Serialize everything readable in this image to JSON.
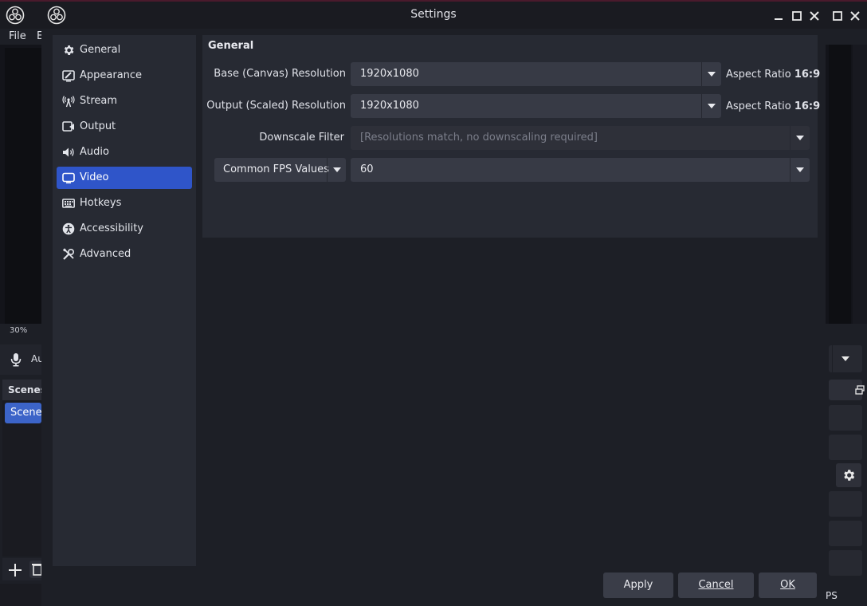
{
  "window": {
    "title": "Settings"
  },
  "background_app": {
    "menu_file": "File",
    "menu_edit": "E",
    "zoom": "30%",
    "mixer_label": "Au",
    "scenes_header": "Scenes",
    "scene_item": "Scene",
    "fps_fragment": "PS"
  },
  "sidebar": {
    "items": [
      {
        "label": "General",
        "icon": "gear-icon"
      },
      {
        "label": "Appearance",
        "icon": "appearance-icon"
      },
      {
        "label": "Stream",
        "icon": "antenna-icon"
      },
      {
        "label": "Output",
        "icon": "output-icon"
      },
      {
        "label": "Audio",
        "icon": "speaker-icon"
      },
      {
        "label": "Video",
        "icon": "monitor-icon",
        "active": true
      },
      {
        "label": "Hotkeys",
        "icon": "keyboard-icon"
      },
      {
        "label": "Accessibility",
        "icon": "accessibility-icon"
      },
      {
        "label": "Advanced",
        "icon": "tools-icon"
      }
    ]
  },
  "video": {
    "section_title": "General",
    "base_resolution": {
      "label": "Base (Canvas) Resolution",
      "value": "1920x1080",
      "aspect_prefix": "Aspect Ratio",
      "aspect_value": "16:9"
    },
    "output_resolution": {
      "label": "Output (Scaled) Resolution",
      "value": "1920x1080",
      "aspect_prefix": "Aspect Ratio",
      "aspect_value": "16:9"
    },
    "downscale_filter": {
      "label": "Downscale Filter",
      "value": "[Resolutions match, no downscaling required]"
    },
    "fps": {
      "type": "Common FPS Values",
      "value": "60"
    }
  },
  "buttons": {
    "apply": "Apply",
    "cancel": "Cancel",
    "ok": "OK"
  },
  "colors": {
    "accent": "#2f55c9",
    "panel": "#272a33",
    "background": "#1d1f26"
  }
}
